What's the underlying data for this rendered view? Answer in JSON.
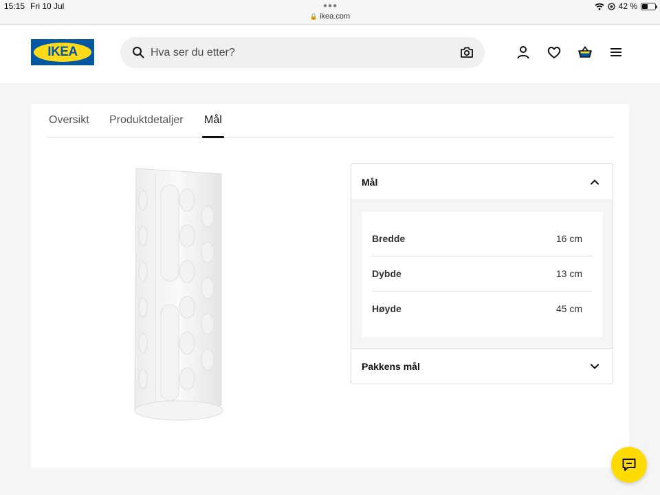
{
  "status_bar": {
    "time": "15:15",
    "date": "Fri 10 Jul",
    "url": "ikea.com",
    "battery": "42 %",
    "battery_level": 0.42
  },
  "header": {
    "logo_text": "IKEA",
    "search_placeholder": "Hva ser du etter?"
  },
  "tabs": [
    {
      "label": "Oversikt",
      "active": false
    },
    {
      "label": "Produktdetaljer",
      "active": false
    },
    {
      "label": "Mål",
      "active": true
    }
  ],
  "dimensions": {
    "title": "Mål",
    "rows": [
      {
        "label": "Bredde",
        "value": "16 cm"
      },
      {
        "label": "Dybde",
        "value": "13 cm"
      },
      {
        "label": "Høyde",
        "value": "45 cm"
      }
    ]
  },
  "package": {
    "title": "Pakkens mål"
  },
  "colors": {
    "brand_blue": "#0058a3",
    "brand_yellow": "#ffda1a",
    "chat_yellow": "#ffdb00"
  },
  "icons": [
    "search-icon",
    "camera-icon",
    "user-icon",
    "heart-icon",
    "basket-icon",
    "menu-icon",
    "chevron-up-icon",
    "chevron-down-icon",
    "chat-icon",
    "wifi-icon",
    "lock-icon"
  ]
}
